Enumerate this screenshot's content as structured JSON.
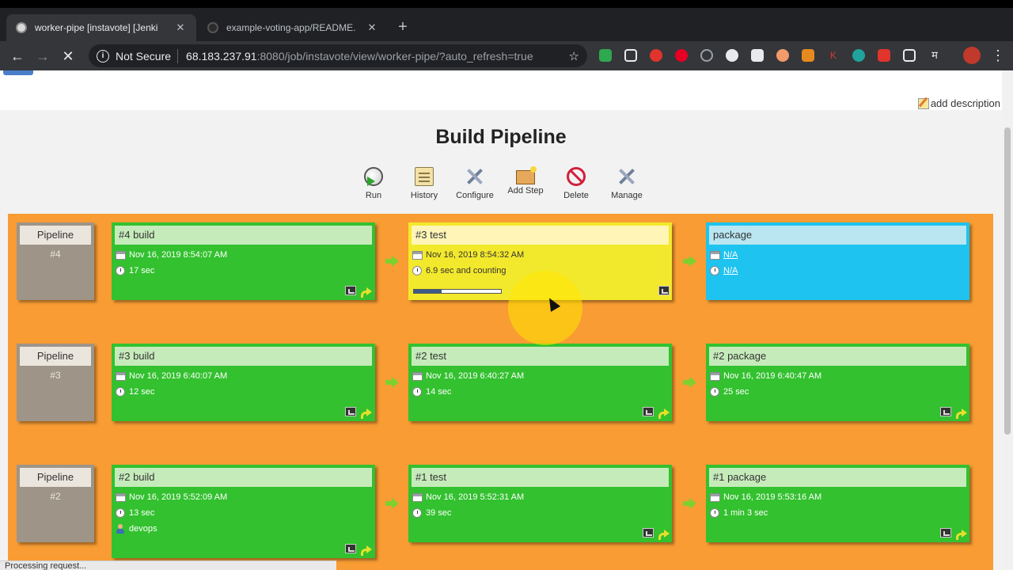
{
  "browser": {
    "tabs": [
      {
        "title": "worker-pipe [instavote] [Jenki",
        "active": true
      },
      {
        "title": "example-voting-app/README.",
        "active": false
      }
    ],
    "new_tab": "+",
    "security_label": "Not Secure",
    "url_host": "68.183.237.91",
    "url_path": ":8080/job/instavote/view/worker-pipe/?auto_refresh=true",
    "status_text": "Processing request..."
  },
  "page": {
    "add_description": "add description",
    "title": "Build Pipeline",
    "actions": [
      {
        "label": "Run",
        "icon": "run-icon"
      },
      {
        "label": "History",
        "icon": "history-icon"
      },
      {
        "label": "Configure",
        "icon": "configure-icon"
      },
      {
        "label": "Add Step",
        "icon": "add-step-icon"
      },
      {
        "label": "Delete",
        "icon": "delete-icon"
      },
      {
        "label": "Manage",
        "icon": "manage-icon"
      }
    ]
  },
  "pipelines": [
    {
      "label": "Pipeline",
      "number": "#4",
      "stages": [
        {
          "title": "#4 build",
          "status": "success",
          "date": "Nov 16, 2019 8:54:07 AM",
          "duration": "17 sec"
        },
        {
          "title": "#3 test",
          "status": "running",
          "date": "Nov 16, 2019 8:54:32 AM",
          "duration": "6.9 sec and counting",
          "progress": 0.32
        },
        {
          "title": "package",
          "status": "pending",
          "date": "N/A",
          "duration": "N/A"
        }
      ]
    },
    {
      "label": "Pipeline",
      "number": "#3",
      "stages": [
        {
          "title": "#3 build",
          "status": "success",
          "date": "Nov 16, 2019 6:40:07 AM",
          "duration": "12 sec"
        },
        {
          "title": "#2 test",
          "status": "success",
          "date": "Nov 16, 2019 6:40:27 AM",
          "duration": "14 sec"
        },
        {
          "title": "#2 package",
          "status": "success",
          "date": "Nov 16, 2019 6:40:47 AM",
          "duration": "25 sec"
        }
      ]
    },
    {
      "label": "Pipeline",
      "number": "#2",
      "stages": [
        {
          "title": "#2 build",
          "status": "success",
          "date": "Nov 16, 2019 5:52:09 AM",
          "duration": "13 sec",
          "user": "devops"
        },
        {
          "title": "#1 test",
          "status": "success",
          "date": "Nov 16, 2019 5:52:31 AM",
          "duration": "39 sec"
        },
        {
          "title": "#1 package",
          "status": "success",
          "date": "Nov 16, 2019 5:53:16 AM",
          "duration": "1 min 3 sec"
        }
      ]
    }
  ],
  "colors": {
    "success": "#33c12f",
    "running": "#f3e92c",
    "pending": "#1ec3ef",
    "pipeline_bg": "#f89c33"
  }
}
